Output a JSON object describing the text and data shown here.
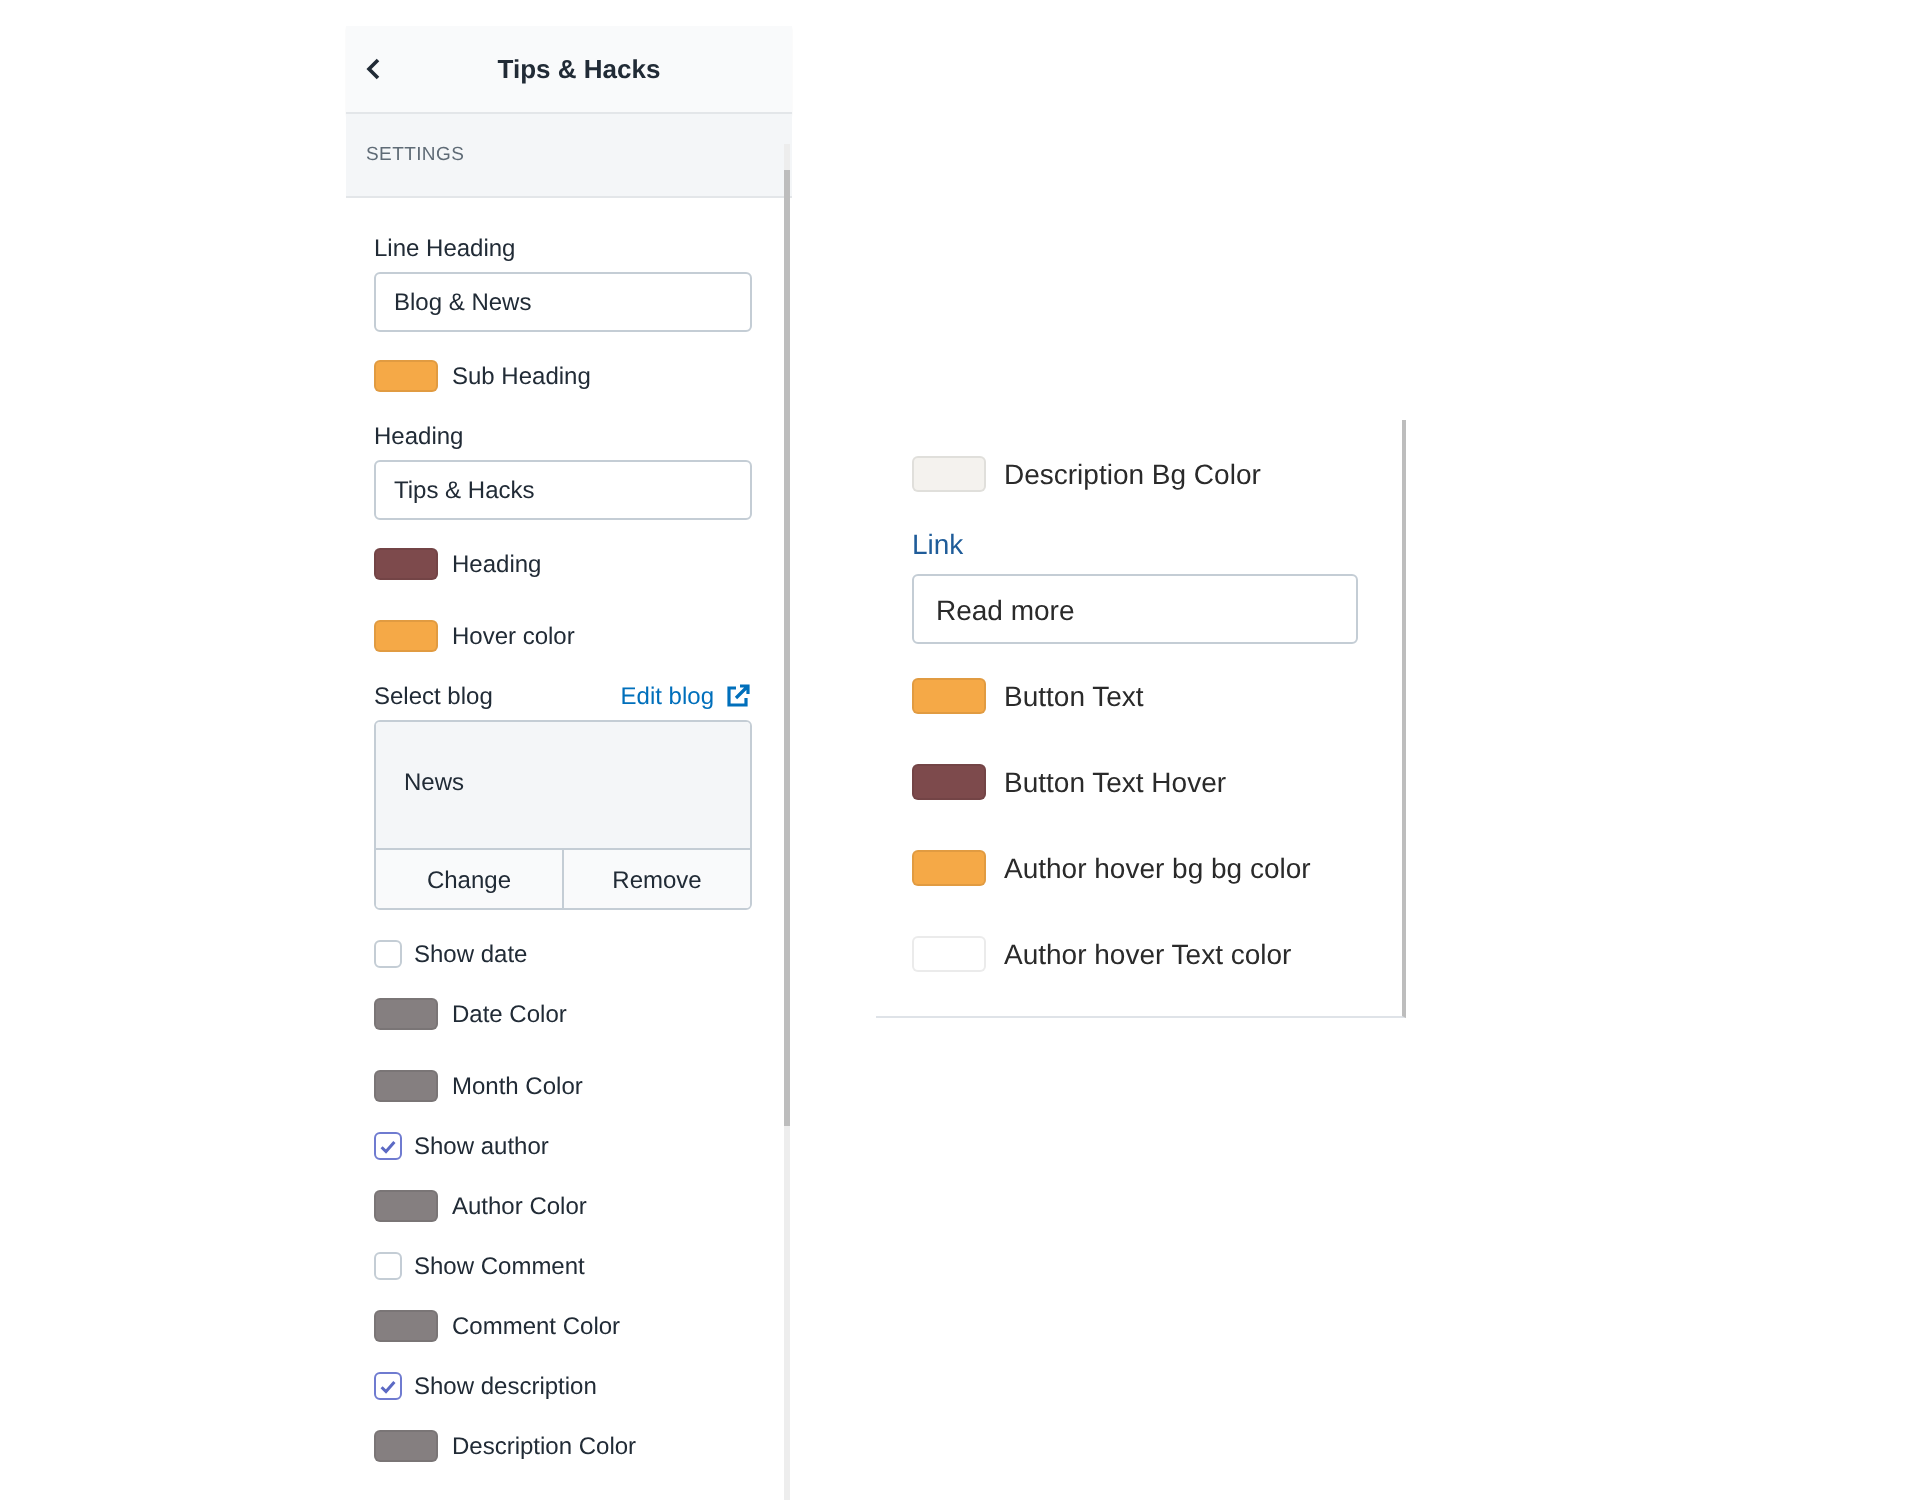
{
  "sidebar": {
    "title": "Tips & Hacks",
    "section": "SETTINGS",
    "settings": [
      {
        "kind": "text",
        "label": "Line Heading",
        "value": "Blog & News"
      },
      {
        "kind": "color",
        "label": "Sub Heading",
        "color": "#f5a947"
      },
      {
        "kind": "text",
        "label": "Heading",
        "value": "Tips & Hacks"
      },
      {
        "kind": "color",
        "label": "Heading",
        "color": "#7d4a4c"
      },
      {
        "kind": "color",
        "label": "Hover color",
        "color": "#f5a947"
      },
      {
        "kind": "blog",
        "label": "Select blog",
        "link": "Edit blog",
        "value": "News",
        "buttons": [
          "Change",
          "Remove"
        ]
      },
      {
        "kind": "checkbox",
        "label": "Show date",
        "checked": false
      },
      {
        "kind": "color",
        "label": "Date Color",
        "color": "#857f80"
      },
      {
        "kind": "color",
        "label": "Month Color",
        "color": "#857f80"
      },
      {
        "kind": "checkbox",
        "label": "Show author",
        "checked": true
      },
      {
        "kind": "color",
        "label": "Author Color",
        "color": "#857f80"
      },
      {
        "kind": "checkbox",
        "label": "Show Comment",
        "checked": false
      },
      {
        "kind": "color",
        "label": "Comment Color",
        "color": "#857f80"
      },
      {
        "kind": "checkbox",
        "label": "Show description",
        "checked": true
      },
      {
        "kind": "color",
        "label": "Description Color",
        "color": "#857f80"
      }
    ]
  },
  "settings_panel": {
    "settings": [
      {
        "kind": "color",
        "label": "Description Bg Color",
        "color": "#f4f2ee"
      },
      {
        "kind": "text",
        "label": "Link",
        "value": "Read more"
      },
      {
        "kind": "color",
        "label": "Button Text",
        "color": "#f5a947"
      },
      {
        "kind": "color",
        "label": "Button Text Hover",
        "color": "#7d4a4c"
      },
      {
        "kind": "color",
        "label": "Author hover bg bg color",
        "color": "#f5a947"
      },
      {
        "kind": "color",
        "label": "Author hover Text color",
        "color": "#ffffff"
      }
    ]
  }
}
